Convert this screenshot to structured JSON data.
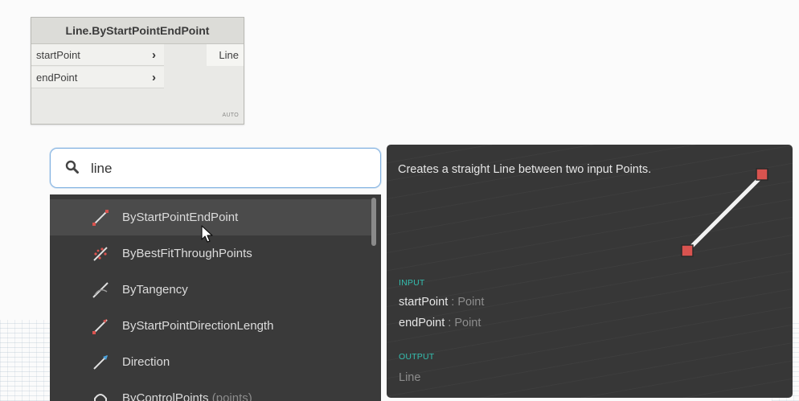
{
  "node": {
    "title": "Line.ByStartPointEndPoint",
    "inputs": [
      "startPoint",
      "endPoint"
    ],
    "output": "Line",
    "lacing": "AUTO"
  },
  "search": {
    "value": "line",
    "icon": "search-icon"
  },
  "results": [
    {
      "label": "ByStartPointEndPoint",
      "params": "",
      "icon": "line-create-icon"
    },
    {
      "label": "ByBestFitThroughPoints",
      "params": "",
      "icon": "line-bestfit-icon"
    },
    {
      "label": "ByTangency",
      "params": "",
      "icon": "line-tangency-icon"
    },
    {
      "label": "ByStartPointDirectionLength",
      "params": "",
      "icon": "line-direction-length-icon"
    },
    {
      "label": "Direction",
      "params": "",
      "icon": "line-direction-icon"
    },
    {
      "label": "ByControlPoints",
      "params": "(points)",
      "icon": "curve-control-points-icon"
    }
  ],
  "tooltip": {
    "description": "Creates a straight Line between two input Points.",
    "input_label": "INPUT",
    "inputs": [
      {
        "name": "startPoint",
        "type": ": Point"
      },
      {
        "name": "endPoint",
        "type": ": Point"
      }
    ],
    "output_label": "OUTPUT",
    "output": "Line"
  },
  "colors": {
    "accent": "#34bfb0",
    "point": "#d9534f",
    "panel": "#373737"
  }
}
